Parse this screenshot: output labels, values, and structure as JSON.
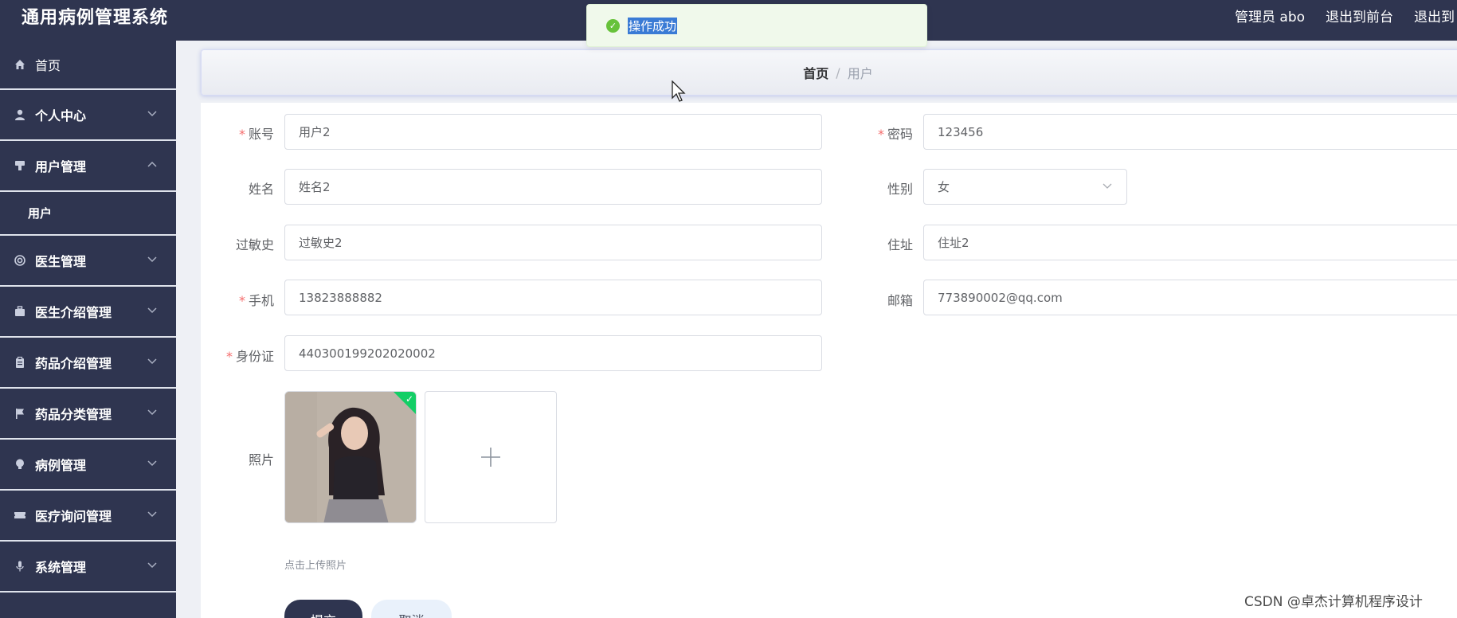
{
  "header": {
    "app_title": "通用病例管理系统",
    "admin_label": "管理员 abo",
    "exit_front": "退出到前台",
    "exit_system": "退出到"
  },
  "toast": {
    "message": "操作成功",
    "color": "#67c23a"
  },
  "sidebar": {
    "items": [
      {
        "label": "首页",
        "icon": "home-icon"
      },
      {
        "label": "个人中心",
        "icon": "person-icon"
      },
      {
        "label": "用户管理",
        "icon": "users-icon",
        "expanded": true
      },
      {
        "label": "用户"
      },
      {
        "label": "医生管理",
        "icon": "lifebuoy-icon"
      },
      {
        "label": "医生介绍管理",
        "icon": "briefcase-icon"
      },
      {
        "label": "药品介绍管理",
        "icon": "clipboard-icon"
      },
      {
        "label": "药品分类管理",
        "icon": "flag-icon"
      },
      {
        "label": "病例管理",
        "icon": "bulb-icon"
      },
      {
        "label": "医疗询问管理",
        "icon": "ticket-icon"
      },
      {
        "label": "系统管理",
        "icon": "mic-icon"
      }
    ]
  },
  "breadcrumb": {
    "home": "首页",
    "separator": "/",
    "current": "用户"
  },
  "form": {
    "account": {
      "label": "账号",
      "value": "用户2",
      "required": true
    },
    "password": {
      "label": "密码",
      "value": "123456",
      "required": true
    },
    "name": {
      "label": "姓名",
      "value": "姓名2"
    },
    "gender": {
      "label": "性别",
      "value": "女"
    },
    "allergy": {
      "label": "过敏史",
      "value": "过敏史2"
    },
    "address": {
      "label": "住址",
      "value": "住址2"
    },
    "phone": {
      "label": "手机",
      "value": "13823888882",
      "required": true
    },
    "email": {
      "label": "邮箱",
      "value": "773890002@qq.com"
    },
    "id_card": {
      "label": "身份证",
      "value": "440300199202020002",
      "required": true
    },
    "photo": {
      "label": "照片",
      "upload_hint": "点击上传照片"
    }
  },
  "buttons": {
    "submit": "提交",
    "cancel": "取消"
  },
  "watermark": "CSDN @卓杰计算机程序设计",
  "colors": {
    "sidebar_bg": "#2f3550",
    "required_star": "#f56c6c",
    "success": "#67c23a"
  }
}
